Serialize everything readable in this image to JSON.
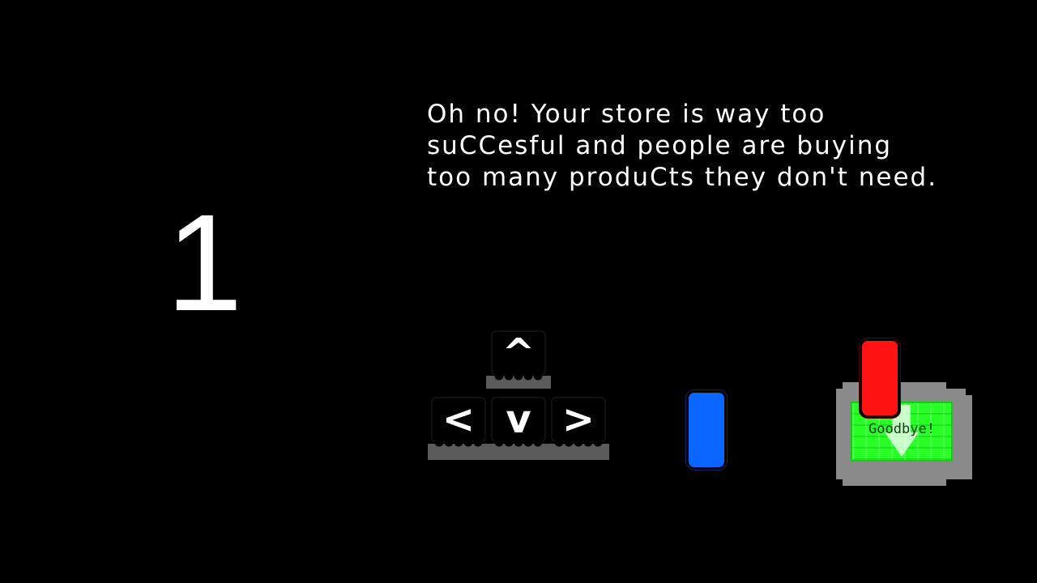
{
  "level": {
    "number": "1"
  },
  "instruction": {
    "lines": [
      "Oh no! Your store is way too",
      "suCCesful and people are buying",
      "too many produCts they don't need."
    ]
  },
  "controls": {
    "up": "^",
    "left": "<",
    "down": "v",
    "right": ">"
  },
  "exit": {
    "label": "Goodbye!",
    "color": "#27ff27"
  },
  "players": {
    "blue": {
      "color": "#0a66ff"
    },
    "red": {
      "color": "#ff1212"
    }
  }
}
